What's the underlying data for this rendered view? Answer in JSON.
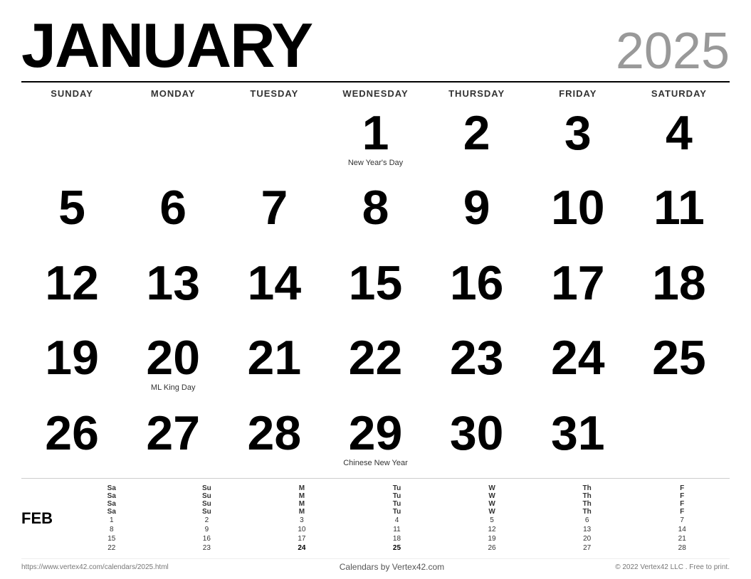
{
  "header": {
    "month": "JANUARY",
    "year": "2025"
  },
  "day_headers": [
    "SUNDAY",
    "MONDAY",
    "TUESDAY",
    "WEDNESDAY",
    "THURSDAY",
    "FRIDAY",
    "SATURDAY"
  ],
  "weeks": [
    [
      {
        "day": "",
        "holiday": ""
      },
      {
        "day": "",
        "holiday": ""
      },
      {
        "day": "",
        "holiday": ""
      },
      {
        "day": "1",
        "holiday": "New Year's Day"
      },
      {
        "day": "2",
        "holiday": ""
      },
      {
        "day": "3",
        "holiday": ""
      },
      {
        "day": "4",
        "holiday": ""
      }
    ],
    [
      {
        "day": "5",
        "holiday": ""
      },
      {
        "day": "6",
        "holiday": ""
      },
      {
        "day": "7",
        "holiday": ""
      },
      {
        "day": "8",
        "holiday": ""
      },
      {
        "day": "9",
        "holiday": ""
      },
      {
        "day": "10",
        "holiday": ""
      },
      {
        "day": "11",
        "holiday": ""
      }
    ],
    [
      {
        "day": "12",
        "holiday": ""
      },
      {
        "day": "13",
        "holiday": ""
      },
      {
        "day": "14",
        "holiday": ""
      },
      {
        "day": "15",
        "holiday": ""
      },
      {
        "day": "16",
        "holiday": ""
      },
      {
        "day": "17",
        "holiday": ""
      },
      {
        "day": "18",
        "holiday": ""
      }
    ],
    [
      {
        "day": "19",
        "holiday": ""
      },
      {
        "day": "20",
        "holiday": "ML King Day"
      },
      {
        "day": "21",
        "holiday": ""
      },
      {
        "day": "22",
        "holiday": ""
      },
      {
        "day": "23",
        "holiday": ""
      },
      {
        "day": "24",
        "holiday": ""
      },
      {
        "day": "25",
        "holiday": ""
      }
    ],
    [
      {
        "day": "26",
        "holiday": ""
      },
      {
        "day": "27",
        "holiday": ""
      },
      {
        "day": "28",
        "holiday": ""
      },
      {
        "day": "29",
        "holiday": "Chinese New Year"
      },
      {
        "day": "30",
        "holiday": ""
      },
      {
        "day": "31",
        "holiday": ""
      },
      {
        "day": "",
        "holiday": ""
      }
    ]
  ],
  "mini_calendar": {
    "month_label": "FEB",
    "headers": [
      "Sa",
      "Su",
      "M",
      "Tu",
      "W",
      "Th",
      "F",
      "Sa",
      "Su",
      "M",
      "Tu",
      "W",
      "Th",
      "F",
      "Sa",
      "Su",
      "M",
      "Tu",
      "W",
      "Th",
      "F",
      "Sa",
      "Su",
      "M",
      "Tu",
      "W",
      "Th",
      "F"
    ],
    "days": [
      "1",
      "2",
      "3",
      "4",
      "5",
      "6",
      "7",
      "8",
      "9",
      "10",
      "11",
      "12",
      "13",
      "14",
      "15",
      "16",
      "17",
      "18",
      "19",
      "20",
      "21",
      "22",
      "23",
      "24",
      "25",
      "26",
      "27",
      "28"
    ],
    "bold_days": [
      "24",
      "25"
    ]
  },
  "footer": {
    "left": "https://www.vertex42.com/calendars/2025.html",
    "center": "Calendars by Vertex42.com",
    "right": "© 2022 Vertex42 LLC . Free to print."
  }
}
